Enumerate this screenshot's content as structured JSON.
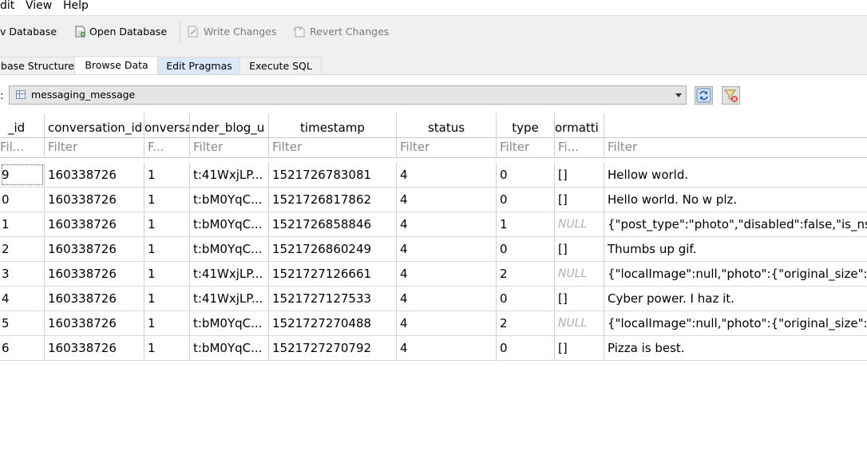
{
  "menu": {
    "edit": "dit",
    "view": "View",
    "help": "Help"
  },
  "toolbar": {
    "new_database": "v Database",
    "open_database": "Open Database",
    "write_changes": "Write Changes",
    "revert_changes": "Revert Changes"
  },
  "tabs": {
    "structure": "base Structure",
    "browse": "Browse Data",
    "pragmas": "Edit Pragmas",
    "sql": "Execute SQL"
  },
  "browse": {
    "table_label": ":",
    "table_name": "messaging_message"
  },
  "grid": {
    "headers": [
      "_id",
      "conversation_id",
      "onversa",
      "nder_blog_u",
      "timestamp",
      "status",
      "type",
      "ormatti",
      ""
    ],
    "filters": [
      "Fil...",
      "Filter",
      "F...",
      "Filter",
      "Filter",
      "Filter",
      "Filter",
      "Fi...",
      "Filter"
    ],
    "rows": [
      [
        "9",
        "160338726",
        "1",
        "t:41WxjLP...",
        "1521726783081",
        "4",
        "0",
        "[]",
        "Hellow world."
      ],
      [
        "0",
        "160338726",
        "1",
        "t:bM0YqC...",
        "1521726817862",
        "4",
        "0",
        "[]",
        "Hello world. No w plz."
      ],
      [
        "1",
        "160338726",
        "1",
        "t:bM0YqC...",
        "1521726858846",
        "4",
        "1",
        "NULL",
        "{\"post_type\":\"photo\",\"disabled\":false,\"is_ns"
      ],
      [
        "2",
        "160338726",
        "1",
        "t:bM0YqC...",
        "1521726860249",
        "4",
        "0",
        "[]",
        "Thumbs up gif."
      ],
      [
        "3",
        "160338726",
        "1",
        "t:41WxjLP...",
        "1521727126661",
        "4",
        "2",
        "NULL",
        "{\"localImage\":null,\"photo\":{\"original_size\":{"
      ],
      [
        "4",
        "160338726",
        "1",
        "t:41WxjLP...",
        "1521727127533",
        "4",
        "0",
        "[]",
        "Cyber power. I haz it."
      ],
      [
        "5",
        "160338726",
        "1",
        "t:bM0YqC...",
        "1521727270488",
        "4",
        "2",
        "NULL",
        "{\"localImage\":null,\"photo\":{\"original_size\":{"
      ],
      [
        "6",
        "160338726",
        "1",
        "t:bM0YqC...",
        "1521727270792",
        "4",
        "0",
        "[]",
        "Pizza is best."
      ]
    ]
  }
}
